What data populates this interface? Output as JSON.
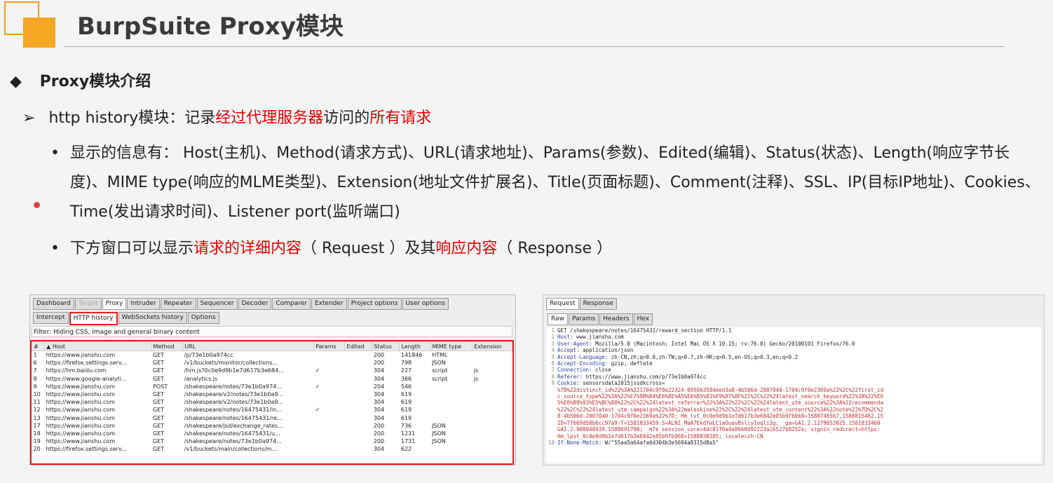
{
  "slide": {
    "title": "BurpSuite Proxy模块",
    "heading": "Proxy模块介绍",
    "sub_prefix": "http history模块：记录",
    "sub_red1": "经过代理服务器",
    "sub_mid": "访问的",
    "sub_red2": "所有请求",
    "bullet1": "显示的信息有： Host(主机)、Method(请求方式)、URL(请求地址)、Params(参数)、Edited(编辑)、Status(状态)、Length(响应字节长度)、MIME type(响应的MLME类型)、Extension(地址文件扩展名)、Title(页面标题)、Comment(注释)、SSL、IP(目标IP地址)、Cookies、Time(发出请求时间)、Listener port(监听端口)",
    "bullet2_a": "下方窗口可以显示",
    "bullet2_red1": "请求的详细内容",
    "bullet2_b": "（ Request ）及其",
    "bullet2_red2": "响应内容",
    "bullet2_c": "（ Response ）",
    "bullet_glyph": "•",
    "heading_glyph": "◆",
    "sub_glyph": "➢"
  },
  "burp": {
    "tabs": [
      "Dashboard",
      "Target",
      "Proxy",
      "Intruder",
      "Repeater",
      "Sequencer",
      "Decoder",
      "Comparer",
      "Extender",
      "Project options",
      "User options"
    ],
    "subtabs": [
      "Intercept",
      "HTTP history",
      "WebSockets history",
      "Options"
    ],
    "filter": "Filter: Hiding CSS, image and general binary content",
    "columns": [
      "#",
      "▲ Host",
      "Method",
      "URL",
      "Params",
      "Edited",
      "Status",
      "Length",
      "MIME type",
      "Extension"
    ],
    "rows": [
      [
        "1",
        "https://www.jianshu.com",
        "GET",
        "/p/73e1b0a974cc",
        "",
        "",
        "200",
        "141846",
        "HTML",
        ""
      ],
      [
        "6",
        "https://firefox.settings.serv...",
        "GET",
        "/v1/buckets/monitor/collections...",
        "",
        "",
        "200",
        "798",
        "JSON",
        ""
      ],
      [
        "7",
        "https://hm.baidu.com",
        "GET",
        "/hm.js?0c0e9d9b1e7d617b3e684...",
        "✓",
        "",
        "304",
        "227",
        "script",
        "js"
      ],
      [
        "8",
        "https://www.google-analyti...",
        "GET",
        "/analytics.js",
        "",
        "",
        "304",
        "366",
        "script",
        "js"
      ],
      [
        "9",
        "https://www.jianshu.com",
        "POST",
        "/shakespeare/notes/73e1b0a974...",
        "✓",
        "",
        "204",
        "546",
        "",
        ""
      ],
      [
        "10",
        "https://www.jianshu.com",
        "GET",
        "/shakespeare/v2/notes/73e1b0a9...",
        "",
        "",
        "304",
        "619",
        "",
        ""
      ],
      [
        "11",
        "https://www.jianshu.com",
        "GET",
        "/shakespeare/v2/notes/73e1b0a9...",
        "",
        "",
        "304",
        "619",
        "",
        ""
      ],
      [
        "12",
        "https://www.jianshu.com",
        "GET",
        "/shakespeare/notes/16475431/in...",
        "✓",
        "",
        "304",
        "619",
        "",
        ""
      ],
      [
        "13",
        "https://www.jianshu.com",
        "GET",
        "/shakespeare/notes/16475431/re...",
        "",
        "",
        "304",
        "619",
        "",
        ""
      ],
      [
        "17",
        "https://www.jianshu.com",
        "GET",
        "/shakespeare/jsd/exchange_rates...",
        "",
        "",
        "200",
        "736",
        "JSON",
        ""
      ],
      [
        "18",
        "https://www.jianshu.com",
        "GET",
        "/shakespeare/notes/16475431/u...",
        "",
        "",
        "200",
        "1231",
        "JSON",
        ""
      ],
      [
        "19",
        "https://www.jianshu.com",
        "GET",
        "/shakespeare/notes/73e1b0a974...",
        "",
        "",
        "200",
        "1731",
        "JSON",
        ""
      ],
      [
        "20",
        "https://firefox.settings.serv...",
        "GET",
        "/v1/buckets/main/collections/m...",
        "",
        "",
        "304",
        "622",
        "",
        ""
      ]
    ]
  },
  "request": {
    "tabs": [
      "Request",
      "Response"
    ],
    "subtabs": [
      "Raw",
      "Params",
      "Headers",
      "Hex"
    ],
    "lines": [
      {
        "n": "1",
        "k": "",
        "v": "GET /shakespeare/notes/16475431/reward_section HTTP/1.1"
      },
      {
        "n": "2",
        "k": "Host:",
        "v": " www.jianshu.com"
      },
      {
        "n": "3",
        "k": "User-Agent:",
        "v": " Mozilla/5.0 (Macintosh; Intel Mac OS X 10.15; rv:76.0) Gecko/20100101 Firefox/76.0"
      },
      {
        "n": "4",
        "k": "Accept:",
        "v": " application/json"
      },
      {
        "n": "5",
        "k": "Accept-Language:",
        "v": " zh-CN,zh;q=0.8,zh-TW;q=0.7,zh-HK;q=0.5,en-US;q=0.3,en;q=0.2"
      },
      {
        "n": "6",
        "k": "Accept-Encoding:",
        "v": " gzip, deflate"
      },
      {
        "n": "7",
        "k": "Connection:",
        "v": " close"
      },
      {
        "n": "8",
        "k": "Referer:",
        "v": " https://www.jianshu.com/p/73e1b0a974cc"
      },
      {
        "n": "9",
        "k": "Cookie:",
        "v": " sensorsdata2015jssdkcross="
      },
      {
        "n": "",
        "k": "",
        "v": "%7B%22distinct_id%22%3A%221704c9f0e22324-09506358deed3a8-4b506d-2007040-1704c9f0e2369a%22%2C%22first_id"
      },
      {
        "n": "",
        "k": "",
        "v": "c_source_type%22%3A%22%E7%9B%B4%E6%8E%A5%E6%B5%81%E9%87%8F%22%2C%22%24latest_search_keyword%22%3A%22%E6"
      },
      {
        "n": "",
        "k": "",
        "v": "5%E6%B9%93%E5%BC%80%22%2C%22%24latest_referrer%22%3A%22%22%2C%22%24latest_utm_source%22%3A%22recommenda"
      },
      {
        "n": "",
        "k": "",
        "v": "%22%2C%22%24latest_utm_campaign%22%3A%22maleskine%22%2C%22%24latest_utm_content%22%3A%22note%22%7D%2C%2"
      },
      {
        "n": "",
        "k": "",
        "v": "8-4b506d-2007040-1704c9f0e2369a%22%7D; Hm_lvt_0c0e9d9b1e7d617b3e6842e85b9fb068=1588746567,1588815462,15"
      },
      {
        "n": "",
        "k": "",
        "v": "ID=77669d58b6cc97a9:T=1581833459:S=ALNI_MaA7EkdfwLCiaOuavBsliyIoqli3g; _ga=GA1.2.1279053025.1581833460"
      },
      {
        "n": "",
        "k": "",
        "v": "GA1.2.908048439.1588691798; _m7e_session_core=4dc81f0a4e8660d92223a16527b8252a; signin_redirect=https:"
      },
      {
        "n": "",
        "k": "",
        "v": "Hm_lpvt_0c0e9d9b1e7d617b3e6842e85b9fb068=1588838105; locale=zh-CN"
      },
      {
        "n": "10",
        "k": "If-None-Match:",
        "v": " W/\"55aa5a64afa6d304b3e5694a8315d8a5\""
      }
    ]
  }
}
